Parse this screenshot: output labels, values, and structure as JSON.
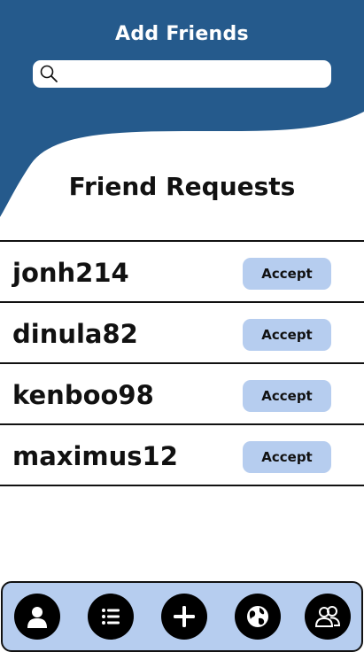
{
  "header": {
    "title": "Add Friends",
    "background_color": "#255a8c"
  },
  "search": {
    "value": "",
    "placeholder": "",
    "icon": "search-icon"
  },
  "requests": {
    "title": "Friend Requests",
    "items": [
      {
        "username": "jonh214",
        "accept_label": "Accept"
      },
      {
        "username": "dinula82",
        "accept_label": "Accept"
      },
      {
        "username": "kenboo98",
        "accept_label": "Accept"
      },
      {
        "username": "maximus12",
        "accept_label": "Accept"
      }
    ],
    "button_color": "#b6cdef"
  },
  "bottom_nav": {
    "background_color": "#b6cdef",
    "items": [
      {
        "icon": "profile-icon"
      },
      {
        "icon": "list-icon"
      },
      {
        "icon": "add-icon"
      },
      {
        "icon": "globe-icon"
      },
      {
        "icon": "friends-icon"
      }
    ]
  }
}
